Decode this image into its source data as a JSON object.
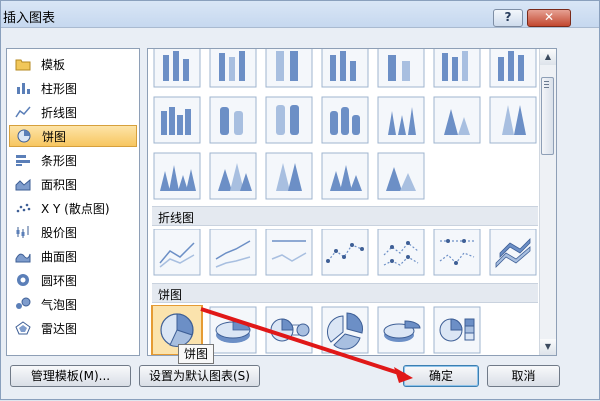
{
  "window": {
    "title": "插入图表",
    "help_label": "?",
    "close_label": "✕"
  },
  "categories": [
    {
      "label": "模板",
      "icon": "folder-icon",
      "selected": false
    },
    {
      "label": "柱形图",
      "icon": "column-chart-icon",
      "selected": false
    },
    {
      "label": "折线图",
      "icon": "line-chart-icon",
      "selected": false
    },
    {
      "label": "饼图",
      "icon": "pie-chart-icon",
      "selected": true
    },
    {
      "label": "条形图",
      "icon": "bar-chart-icon",
      "selected": false
    },
    {
      "label": "面积图",
      "icon": "area-chart-icon",
      "selected": false
    },
    {
      "label": "X Y (散点图)",
      "icon": "scatter-chart-icon",
      "selected": false
    },
    {
      "label": "股价图",
      "icon": "stock-chart-icon",
      "selected": false
    },
    {
      "label": "曲面图",
      "icon": "surface-chart-icon",
      "selected": false
    },
    {
      "label": "圆环图",
      "icon": "doughnut-chart-icon",
      "selected": false
    },
    {
      "label": "气泡图",
      "icon": "bubble-chart-icon",
      "selected": false
    },
    {
      "label": "雷达图",
      "icon": "radar-chart-icon",
      "selected": false
    }
  ],
  "gallery": {
    "line_section_title": "折线图",
    "pie_section_title": "饼图",
    "pie_types": [
      "饼图",
      "三维饼图",
      "复合饼图",
      "分离型饼图",
      "分离型三维饼图",
      "复合条饼图"
    ]
  },
  "tooltip": "饼图",
  "buttons": {
    "manage_templates": "管理模板(M)...",
    "set_default": "设置为默认图表(S)",
    "ok": "确定",
    "cancel": "取消"
  },
  "colors": {
    "selection": "#f7c660",
    "annotation_arrow": "#e01818",
    "chart_blue": "#5b7fb8"
  }
}
